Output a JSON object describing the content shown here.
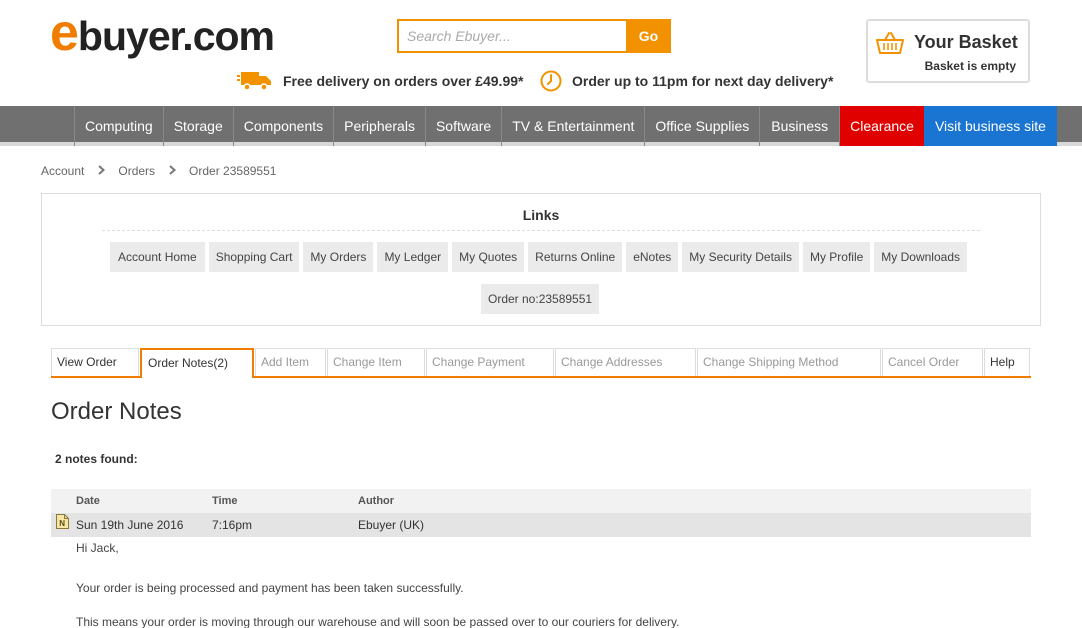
{
  "header": {
    "logo_e": "e",
    "logo_rest": "buyer.com",
    "search_placeholder": "Search Ebuyer...",
    "search_button": "Go",
    "promo_delivery": "Free delivery on orders over £49.99*",
    "promo_order": "Order up to 11pm for next day delivery*",
    "basket_title": "Your Basket",
    "basket_status": "Basket is empty"
  },
  "nav": {
    "items": [
      "Computing",
      "Storage",
      "Components",
      "Peripherals",
      "Software",
      "TV & Entertainment",
      "Office Supplies",
      "Business"
    ],
    "clearance": "Clearance",
    "business_site": "Visit business site",
    "clearance_color": "#e10000",
    "business_site_color": "#1a75d2"
  },
  "breadcrumb": {
    "items": [
      "Account",
      "Orders",
      "Order 23589551"
    ]
  },
  "links": {
    "title": "Links",
    "items": [
      "Account Home",
      "Shopping Cart",
      "My Orders",
      "My Ledger",
      "My Quotes",
      "Returns Online",
      "eNotes",
      "My Security Details",
      "My Profile",
      "My Downloads"
    ],
    "order_no": "Order no:23589551"
  },
  "tabs": {
    "items": [
      "View Order",
      "Order Notes(2)",
      "Add Item",
      "Change Item",
      "Change Payment",
      "Change Addresses",
      "Change Shipping Method",
      "Cancel Order",
      "Help"
    ],
    "active": "Order Notes(2)"
  },
  "page": {
    "title": "Order Notes",
    "notes_found": "2 notes found:"
  },
  "notes_table": {
    "headers": {
      "date": "Date",
      "time": "Time",
      "author": "Author"
    },
    "rows": [
      {
        "date": "Sun 19th June 2016",
        "time": "7:16pm",
        "author": "Ebuyer (UK)",
        "icon": "note-icon",
        "body": [
          "Hi Jack,",
          "Your order is being processed and payment has been taken successfully.",
          "This means your order is moving through our warehouse and will soon be passed over to our couriers for delivery."
        ]
      }
    ]
  },
  "colors": {
    "accent": "#f39200",
    "nav_bg": "#707070"
  }
}
